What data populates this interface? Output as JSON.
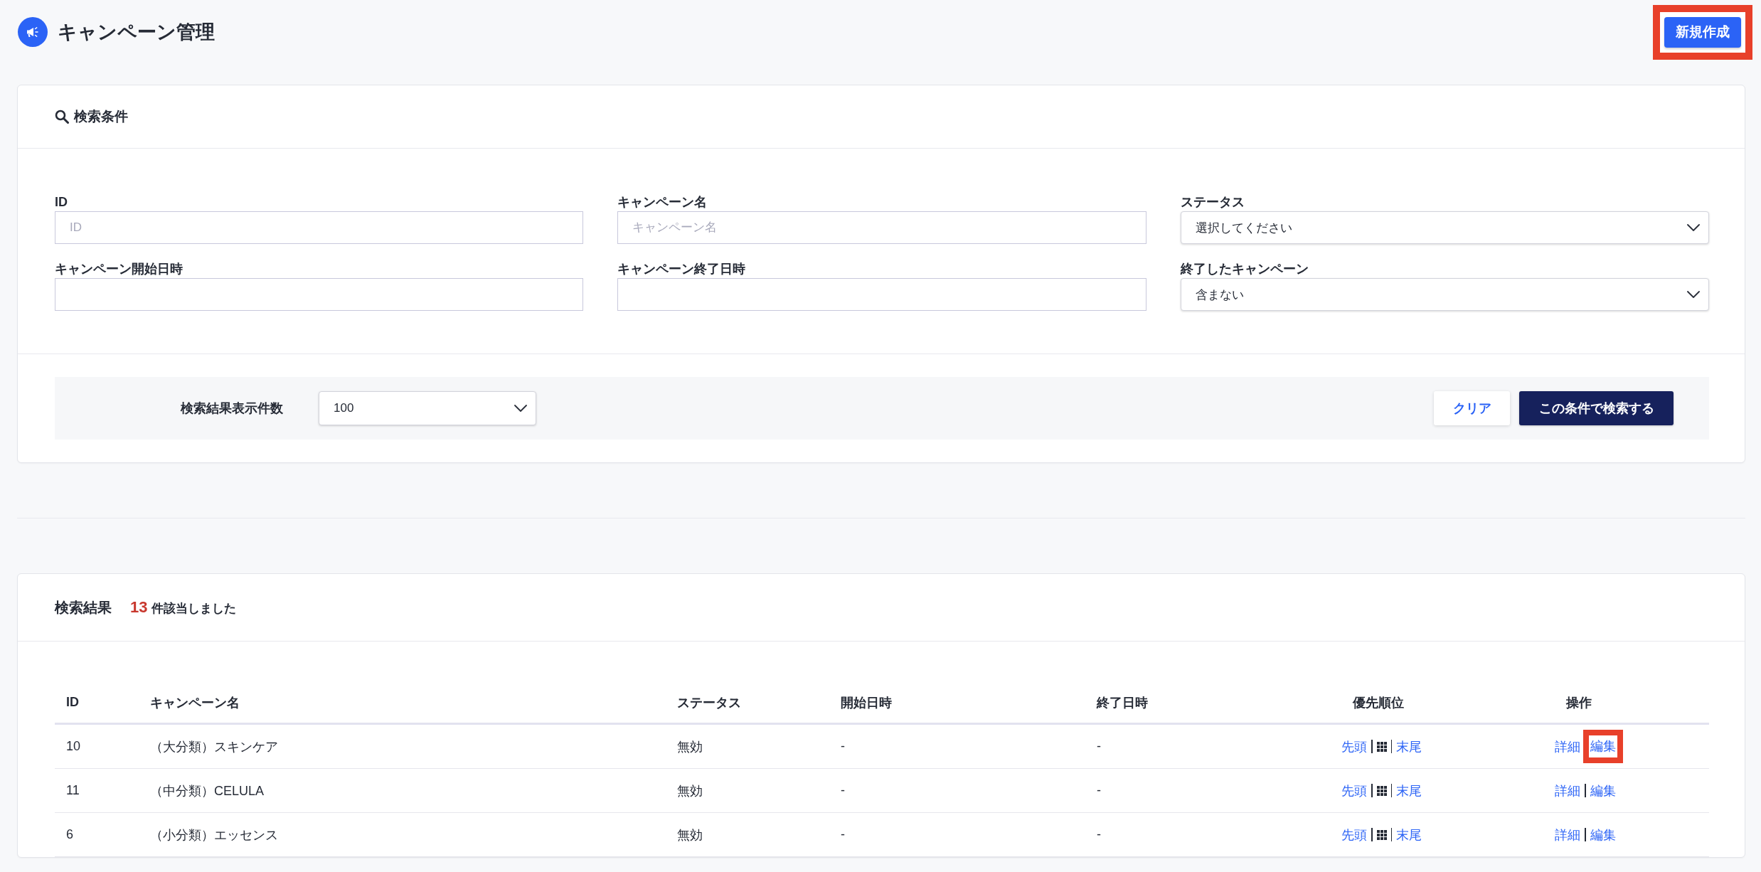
{
  "header": {
    "title": "キャンペーン管理",
    "new_button": {
      "label": "新規作成",
      "highlighted": true
    }
  },
  "search_panel": {
    "title": "検索条件",
    "fields": [
      {
        "kind": "input",
        "label": "ID",
        "placeholder": "ID"
      },
      {
        "kind": "input",
        "label": "キャンペーン名",
        "placeholder": "キャンペーン名"
      },
      {
        "kind": "select",
        "label": "ステータス",
        "value": "選択してください"
      },
      {
        "kind": "input",
        "label": "キャンペーン開始日時"
      },
      {
        "kind": "input",
        "label": "キャンペーン終了日時"
      },
      {
        "kind": "select",
        "label": "終了したキャンペーン",
        "value": "含まない"
      }
    ],
    "page_size": {
      "label": "検索結果表示件数",
      "value": "100"
    },
    "buttons": [
      {
        "kind": "secondary",
        "label": "クリア"
      },
      {
        "kind": "primary",
        "label": "この条件で検索する"
      }
    ]
  },
  "results": {
    "title": "検索結果",
    "count": "13",
    "count_suffix": "件該当しました",
    "columns": [
      "ID",
      "キャンペーン名",
      "ステータス",
      "開始日時",
      "終了日時",
      "優先順位",
      "操作"
    ],
    "rows": [
      {
        "id": "10",
        "name": "（大分類）スキンケア",
        "status": "無効",
        "start": "-",
        "end": "-",
        "priority": {
          "first": "先頭",
          "last": "末尾"
        },
        "actions": [
          {
            "label": "詳細",
            "highlighted": false
          },
          {
            "label": "編集",
            "highlighted": true
          }
        ]
      },
      {
        "id": "11",
        "name": "（中分類）CELULA",
        "status": "無効",
        "start": "-",
        "end": "-",
        "priority": {
          "first": "先頭",
          "last": "末尾"
        },
        "actions": [
          {
            "label": "詳細",
            "highlighted": false
          },
          {
            "label": "編集",
            "highlighted": false
          }
        ]
      },
      {
        "id": "6",
        "name": "（小分類）エッセンス",
        "status": "無効",
        "start": "-",
        "end": "-",
        "priority": {
          "first": "先頭",
          "last": "末尾"
        },
        "actions": [
          {
            "label": "詳細",
            "highlighted": false
          },
          {
            "label": "編集",
            "highlighted": false
          }
        ]
      }
    ]
  }
}
